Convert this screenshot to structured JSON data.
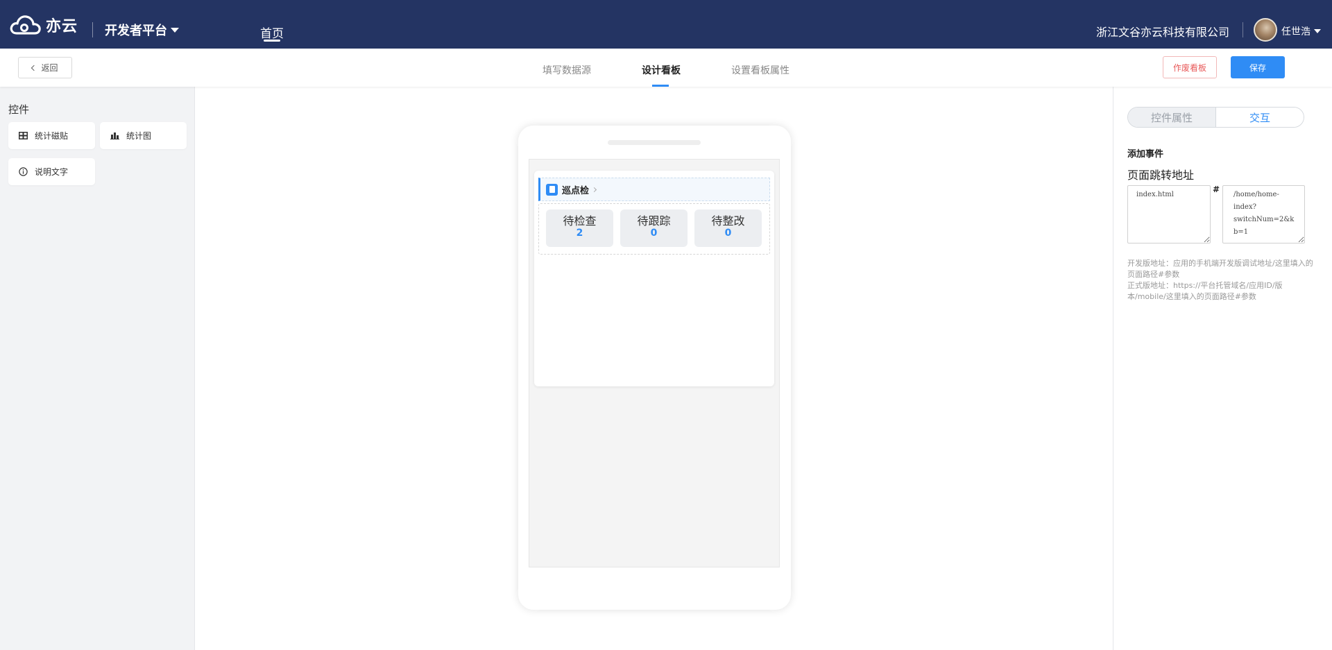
{
  "header": {
    "brand": "亦云",
    "platform": "开发者平台",
    "nav_home": "首页",
    "company": "浙江文谷亦云科技有限公司",
    "username": "任世浩"
  },
  "toolbar": {
    "back_label": "返回",
    "tabs": [
      "填写数据源",
      "设计看板",
      "设置看板属性"
    ],
    "active_tab": "设计看板",
    "void_label": "作废看板",
    "save_label": "保存"
  },
  "left_panel": {
    "title": "控件",
    "items": [
      {
        "label": "统计磁贴",
        "icon": "tile-grid-icon"
      },
      {
        "label": "统计图",
        "icon": "bar-chart-icon"
      },
      {
        "label": "说明文字",
        "icon": "info-circle-icon"
      }
    ]
  },
  "preview": {
    "card_title": "巡点检",
    "card_icon": "document-icon",
    "stats": [
      {
        "label": "待检查",
        "value": "2"
      },
      {
        "label": "待跟踪",
        "value": "0"
      },
      {
        "label": "待整改",
        "value": "0"
      }
    ]
  },
  "right_panel": {
    "tabs": [
      "控件属性",
      "交互"
    ],
    "active_tab": "交互",
    "section_title": "添加事件",
    "field_label": "页面跳转地址",
    "url_left": "index.html",
    "url_separator": "#",
    "url_right": "/home/home-index?switchNum=2&kb=1",
    "help_line1": "开发版地址：应用的手机端开发版调试地址/这里填入的页面路径#参数",
    "help_line2": "正式版地址：https://平台托管域名/应用ID/版本/mobile/这里填入的页面路径#参数"
  },
  "colors": {
    "header_bg": "#243463",
    "accent": "#2f8cf5",
    "danger": "#e85a5a",
    "panel_bg": "#f2f3f5"
  }
}
